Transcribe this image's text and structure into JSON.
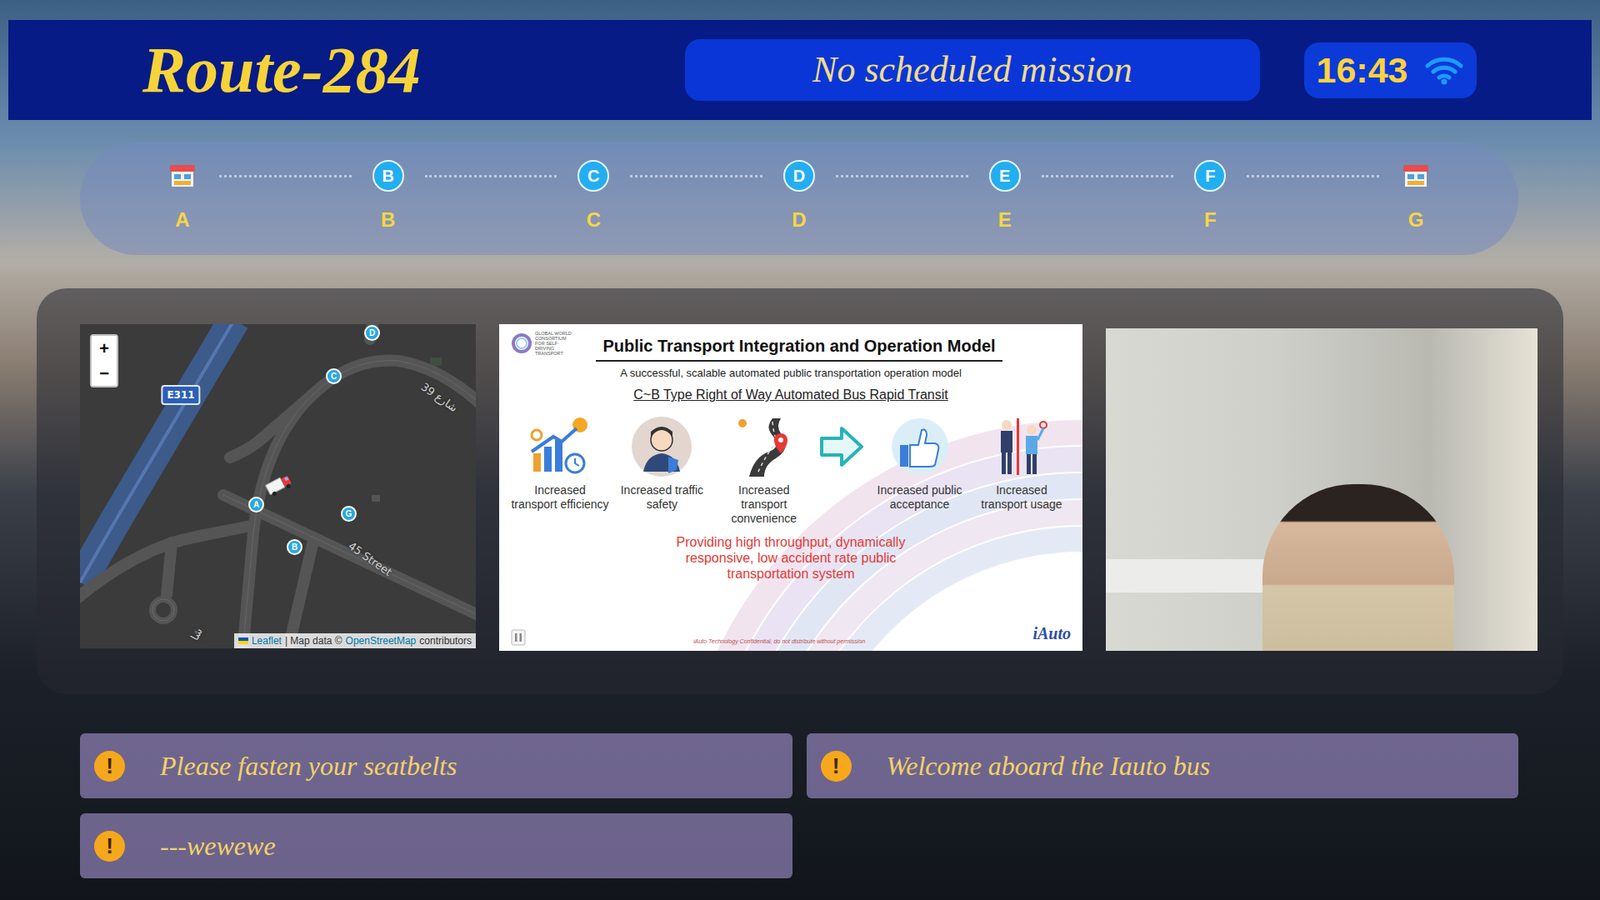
{
  "header": {
    "route": "Route-284",
    "mission": "No scheduled mission",
    "time": "16:43",
    "wifi": {
      "connected": true
    }
  },
  "stops": [
    {
      "kind": "terminal",
      "badge": "",
      "label": "A"
    },
    {
      "kind": "stop",
      "badge": "B",
      "label": "B"
    },
    {
      "kind": "stop",
      "badge": "C",
      "label": "C"
    },
    {
      "kind": "stop",
      "badge": "D",
      "label": "D"
    },
    {
      "kind": "stop",
      "badge": "E",
      "label": "E"
    },
    {
      "kind": "stop",
      "badge": "F",
      "label": "F"
    },
    {
      "kind": "terminal",
      "badge": "",
      "label": "G"
    }
  ],
  "map": {
    "zoom_in": "+",
    "zoom_out": "−",
    "labels": [
      {
        "text": "E311",
        "kind": "shield"
      },
      {
        "text": "شارع 39",
        "kind": "street"
      },
      {
        "text": "45 Street",
        "kind": "street"
      },
      {
        "text": "شا",
        "kind": "street"
      }
    ],
    "pins": [
      {
        "label": "D"
      },
      {
        "label": "C"
      },
      {
        "label": "A"
      },
      {
        "label": "G"
      },
      {
        "label": "B"
      }
    ],
    "attribution": {
      "leaflet": "Leaflet",
      "separator": "| Map data ©",
      "osm": "OpenStreetMap",
      "suffix": "contributors"
    }
  },
  "slide": {
    "logo_text": "GLOBAL WORLD CONSORTIUM FOR SELF-DRIVING TRANSPORT",
    "title": "Public Transport Integration and Operation Model",
    "subtitle": "A successful, scalable automated public transportation operation model",
    "heading": "C~B Type Right of Way Automated Bus Rapid Transit",
    "benefits": [
      {
        "kind": "efficiency",
        "label": "Increased transport efficiency"
      },
      {
        "kind": "safety",
        "label": "Increased traffic safety"
      },
      {
        "kind": "convenience",
        "label": "Increased transport convenience"
      },
      {
        "kind": "arrow",
        "label": ""
      },
      {
        "kind": "acceptance",
        "label": "Increased public acceptance"
      },
      {
        "kind": "usage",
        "label": "Increased transport usage"
      }
    ],
    "conclusion": "Providing high throughput, dynamically responsive, low accident rate public transportation system",
    "footnote": "iAuto Technology Confidential, do not distribute without permission",
    "brand": "iAuto"
  },
  "notices": [
    {
      "icon": "!",
      "text": "Please fasten your seatbelts"
    },
    {
      "icon": "!",
      "text": "Welcome aboard the Iauto bus"
    },
    {
      "icon": "!",
      "text": "---wewewe"
    }
  ]
}
